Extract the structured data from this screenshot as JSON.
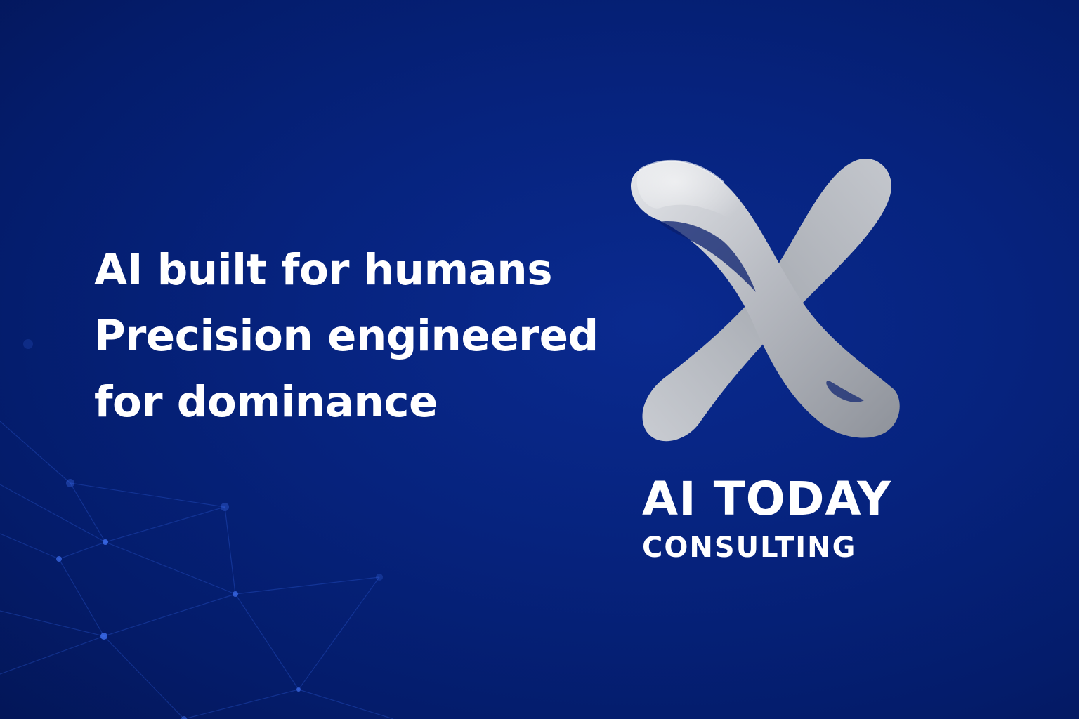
{
  "hero": {
    "tagline_lines": [
      "AI built for humans",
      "Precision engineered",
      "for dominance"
    ]
  },
  "brand": {
    "name": "AI TODAY",
    "subtitle": "CONSULTING",
    "logo_icon": "silver-x-icon"
  },
  "colors": {
    "background": "#06237e",
    "text": "#ffffff",
    "logo_silver": "#b8bcc4"
  }
}
